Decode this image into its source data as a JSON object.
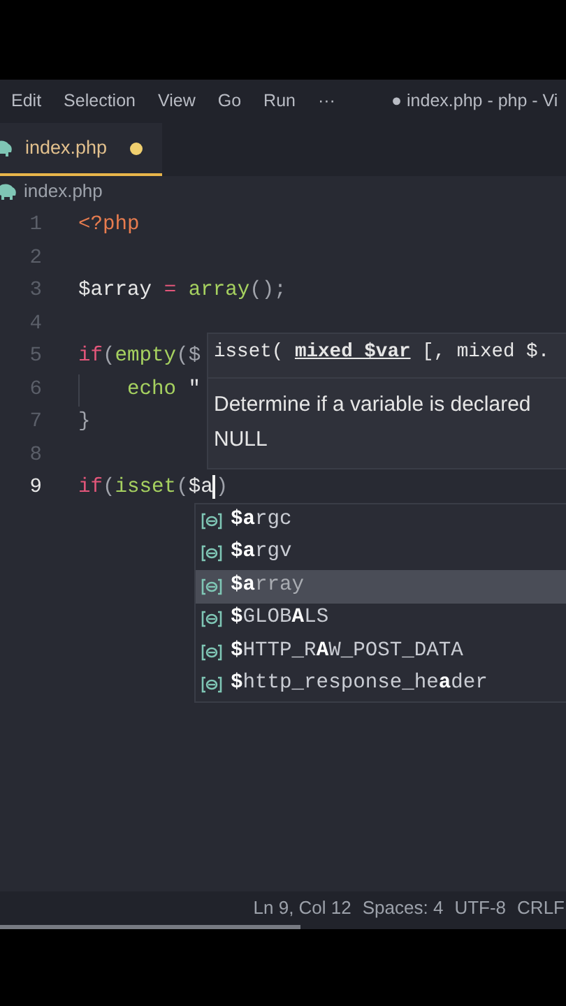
{
  "menu": [
    "Edit",
    "Selection",
    "View",
    "Go",
    "Run",
    "···"
  ],
  "window": {
    "title": "● index.php - php - Vi"
  },
  "tabs": [
    {
      "label": "index.php",
      "selected": true,
      "modified": true
    }
  ],
  "breadcrumb": [
    "index.php"
  ],
  "editor": {
    "lines": [
      {
        "number": "1",
        "tokens": [
          {
            "kind": "tag",
            "text": "<?php"
          }
        ]
      },
      {
        "number": "2"
      },
      {
        "number": "3",
        "tokens": [
          {
            "kind": "var",
            "text": "$array "
          },
          {
            "kind": "op",
            "text": "= "
          },
          {
            "kind": "func",
            "text": "array"
          },
          {
            "kind": "punct",
            "text": "();"
          }
        ]
      },
      {
        "number": "4"
      },
      {
        "number": "5",
        "tokens": [
          {
            "kind": "keyword",
            "text": "if"
          },
          {
            "kind": "punct",
            "text": "("
          },
          {
            "kind": "func",
            "text": "empty"
          },
          {
            "kind": "punct",
            "text": "($"
          }
        ]
      },
      {
        "number": "6",
        "indent": true,
        "tokens": [
          {
            "kind": "func",
            "text": "echo "
          },
          {
            "kind": "plain",
            "text": "\""
          }
        ]
      },
      {
        "number": "7",
        "tokens": [
          {
            "kind": "punct",
            "text": "}"
          }
        ]
      },
      {
        "number": "8"
      },
      {
        "number": "9",
        "current": true,
        "tokens": [
          {
            "kind": "keyword",
            "text": "if"
          },
          {
            "kind": "punct",
            "text": "("
          },
          {
            "kind": "func",
            "text": "isset"
          },
          {
            "kind": "punct",
            "text": "("
          },
          {
            "kind": "var",
            "text": "$a",
            "cursor": true
          },
          {
            "kind": "punct",
            "text": ")"
          }
        ]
      }
    ]
  },
  "hover": {
    "signature": [
      {
        "text": "isset( ",
        "active": false
      },
      {
        "text": "mixed $var",
        "active": true
      },
      {
        "text": " [, mixed $.",
        "active": false
      }
    ],
    "description": [
      "Determine if a variable is declared",
      "NULL"
    ]
  },
  "suggestions": [
    {
      "label": "**$a**rgc",
      "selected": false
    },
    {
      "label": "**$a**rgv",
      "selected": false
    },
    {
      "label": "**$a**rray",
      "selected": true
    },
    {
      "label": "**$**GLOB**A**LS",
      "selected": false
    },
    {
      "label": "**$**HTTP_R**A**W_POST_DATA",
      "selected": false
    },
    {
      "label": "**$**http_response_he**a**der",
      "selected": false
    }
  ],
  "status_bar": [
    "Ln 9, Col 12",
    "Spaces: 4",
    "UTF-8",
    "CRLF"
  ]
}
